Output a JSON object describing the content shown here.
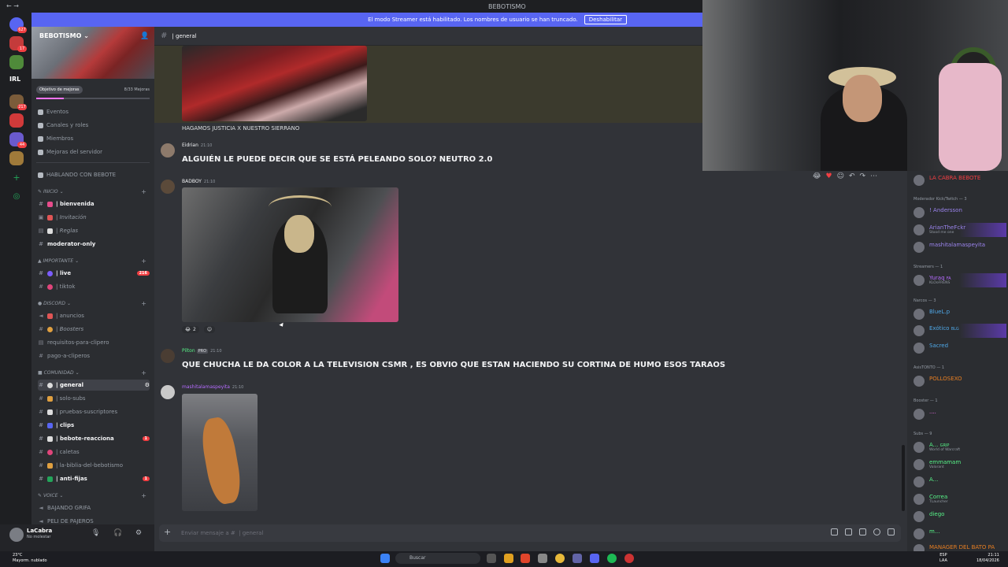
{
  "window": {
    "title": "BEBOTISMO"
  },
  "banner": {
    "text": "El modo Streamer está habilitado. Los nombres de usuario se han truncado.",
    "button": "Deshabilitar"
  },
  "rail": {
    "badges": [
      "627",
      "17",
      "217",
      "44"
    ],
    "srv_label": "IRL"
  },
  "sidebar": {
    "server_name": "BEBOTISMO",
    "boost_goal": "Objetivo de mejoras",
    "boost_count": "8/33 Mejoras",
    "boost_progress": 0.24,
    "top_items": [
      "Eventos",
      "Canales y roles",
      "Miembros",
      "Mejoras del servidor"
    ],
    "event_channel": "HABLANDO CON BEBOTE",
    "categories": {
      "inicio": "INICIO",
      "importante": "IMPORTANTE",
      "discord": "DISCORD",
      "comunidad": "COMUNIDAD",
      "voice": "VOICE"
    },
    "channels": {
      "bienvenida": "| bienvenida",
      "invitacion": "| Invitación",
      "reglas": "| Reglas",
      "moderator": "moderator-only",
      "live": "| live",
      "live_count": "216",
      "tiktok": "| tiktok",
      "anuncios": "| anuncios",
      "boosters": "| Boosters",
      "requisitos": "requisitos-para-clipero",
      "pago": "pago-a-cliperos",
      "general": "| general",
      "solo_subs": "| solo-subs",
      "pruebas": "| pruebas-suscriptores",
      "clips": "| clips",
      "bebote_reacciona": "| bebote-reacciona",
      "bebote_count": "1",
      "caletas": "| caletas",
      "biblia": "| la-biblia-del-bebotismo",
      "antifijas": "| anti-fijas",
      "antifijas_count": "1",
      "bajando": "BAJANDO GRIFA",
      "peli": "PELI DE PAJEROS"
    }
  },
  "user": {
    "name": "LaCabra",
    "status": "No molestar"
  },
  "chat": {
    "channel": "| general",
    "caption": "HAGAMOS JUSTICIA X NUESTRO SIERRANO",
    "messages": [
      {
        "author": "Eidrian",
        "time": "21:10",
        "text": "ALGUIÉN LE PUEDE DECIR QUE SE ESTÁ PELEANDO SOLO? NEUTRO 2.0"
      },
      {
        "author": "BADBOY",
        "time": "21:10",
        "text": ""
      },
      {
        "author": "Pilton",
        "tag": "PRO",
        "time": "21:10",
        "text": "QUE CHUCHA LE DA COLOR A LA TELEVISION CSMR , ES OBVIO QUE ESTAN HACIENDO SU CORTINA DE HUMO ESOS TARAOS"
      },
      {
        "author": "mashitalamaspeyita",
        "time": "21:10",
        "text": ""
      }
    ],
    "reaction_count": "2",
    "input_placeholder": "Enviar mensaje a #  | general"
  },
  "members": {
    "top_name": "LA CABRA BEBOTE",
    "groups": [
      {
        "header": "Moderador Kick/Twitch — 3"
      },
      {
        "header": "Streamers — 1"
      },
      {
        "header": "Narcos — 3"
      },
      {
        "header": "AsisTONTO — 1"
      },
      {
        "header": "Booster — 1"
      },
      {
        "header": "Subs — 9"
      }
    ],
    "names": {
      "anderson": "! Andersson",
      "arian": "ArianTheFckr",
      "arian_sub": "Stood me one",
      "mashi": "mashitalamaspeyita",
      "yuraq": "Yuraq",
      "yuraq_tag": "FA",
      "yuraq_sub": "KLOoFRENS",
      "bluel": "BlueL.p",
      "exotico": "Exótico",
      "exotico_tag": "BLG",
      "sacred": "Sacred",
      "pollo": "POLLOSEXO",
      "booster": "....",
      "a1": "A...",
      "a1_tag": "GRIP",
      "a1_sub": "World of Warcraft",
      "emma": "emmamam",
      "emma_sub": "Valorant",
      "a2": "A...",
      "correa": "Correa",
      "correa_sub": "TLauncher",
      "diego": "diego",
      "m": "m...",
      "manager": "MANAGER DEL BATO PA"
    },
    "colors": {
      "mod": "#9b84ee",
      "stream": "#b66cff",
      "narco": "#4fa8e8",
      "asis": "#e67e22",
      "sub": "#57f287"
    }
  },
  "taskbar": {
    "temp": "23°C",
    "weather": "Mayorm. nublado",
    "search": "Buscar",
    "lang1": "ESP",
    "lang2": "LAA",
    "time": "21:11",
    "date": "18/04/2026"
  }
}
